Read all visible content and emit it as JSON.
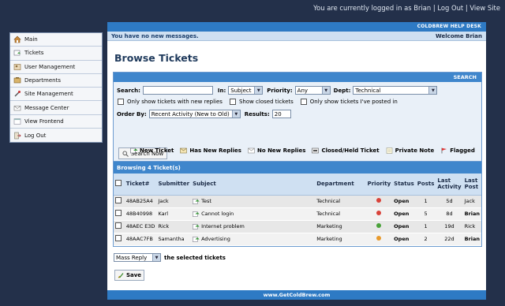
{
  "topbar": {
    "logged_in_text": "You are currently logged in as Brian",
    "logout": "Log Out",
    "view_site": "View Site",
    "sep": "|"
  },
  "sidebar": {
    "items": [
      {
        "label": "Main",
        "icon": "home-icon"
      },
      {
        "label": "Tickets",
        "icon": "tickets-icon"
      },
      {
        "label": "User Management",
        "icon": "users-icon"
      },
      {
        "label": "Departments",
        "icon": "departments-icon"
      },
      {
        "label": "Site Management",
        "icon": "tools-icon"
      },
      {
        "label": "Message Center",
        "icon": "message-icon"
      },
      {
        "label": "View Frontend",
        "icon": "frontend-icon"
      },
      {
        "label": "Log Out",
        "icon": "logout-icon"
      }
    ]
  },
  "header": {
    "app_title": "COLDBREW HELP DESK",
    "messages": "You have no new messages.",
    "welcome": "Welcome Brian"
  },
  "page": {
    "title": "Browse Tickets"
  },
  "search": {
    "section_title": "SEARCH",
    "search_label": "Search:",
    "search_value": "",
    "in_label": "In:",
    "in_value": "Subject",
    "priority_label": "Priority:",
    "priority_value": "Any",
    "dept_label": "Dept:",
    "dept_value": "Technical",
    "opt_new_replies": "Only show tickets with new replies",
    "opt_closed": "Show closed tickets",
    "opt_mine": "Only show tickets I've posted in",
    "order_label": "Order By:",
    "order_value": "Recent Activity (New to Old)",
    "results_label": "Results:",
    "results_value": "20",
    "button": "Search Now"
  },
  "legend": {
    "new_ticket": "New Ticket",
    "has_new_replies": "Has New Replies",
    "no_new_replies": "No New Replies",
    "closed_held": "Closed/Held Ticket",
    "private_note": "Private Note",
    "flagged": "Flagged"
  },
  "tickets": {
    "title": "Browsing 4 Ticket(s)",
    "columns": [
      "Ticket#",
      "Submitter",
      "Subject",
      "Department",
      "Priority",
      "Status",
      "Posts",
      "Last Activity",
      "Last Post"
    ],
    "rows": [
      {
        "id": "48AB25A4",
        "submitter": "Jack",
        "subject": "Test",
        "department": "Technical",
        "priority_color": "#d9433a",
        "status": "Open",
        "posts": "1",
        "last_activity": "5d",
        "last_post": "Jack",
        "last_post_bold": false
      },
      {
        "id": "48B40998",
        "submitter": "Karl",
        "subject": "Cannot login",
        "department": "Technical",
        "priority_color": "#d9433a",
        "status": "Open",
        "posts": "5",
        "last_activity": "8d",
        "last_post": "Brian",
        "last_post_bold": true
      },
      {
        "id": "48AEC E3D",
        "submitter": "Rick",
        "subject": "Internet problem",
        "department": "Marketing",
        "priority_color": "#4aa23a",
        "status": "Open",
        "posts": "1",
        "last_activity": "19d",
        "last_post": "Rick",
        "last_post_bold": false
      },
      {
        "id": "48AAC7FB",
        "submitter": "Samantha",
        "subject": "Advertising",
        "department": "Marketing",
        "priority_color": "#e89a2c",
        "status": "Open",
        "posts": "2",
        "last_activity": "22d",
        "last_post": "Brian",
        "last_post_bold": true
      }
    ]
  },
  "mass": {
    "select_value": "Mass Reply",
    "suffix": "the selected tickets",
    "save": "Save"
  },
  "footer": {
    "text": "www.GetColdBrew.com"
  }
}
